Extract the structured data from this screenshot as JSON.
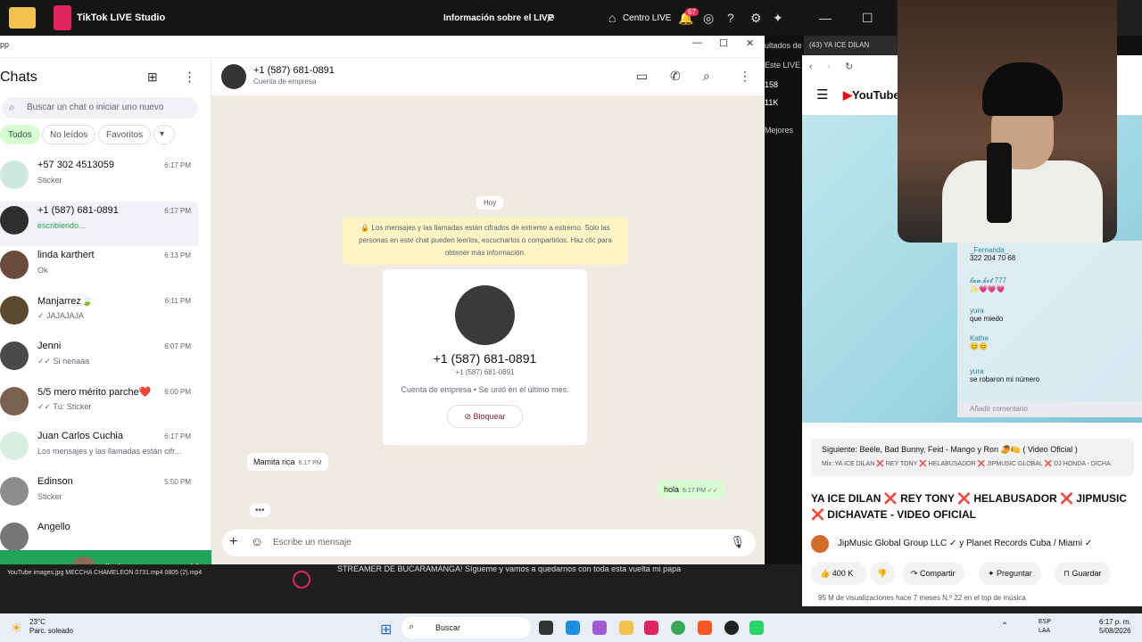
{
  "tiktok_bar": {
    "title": "TikTok LIVE Studio",
    "live_info": "Información sobre el LIVE",
    "centro": "Centro LIVE",
    "notif_count": "67"
  },
  "whatsapp": {
    "app_fragment": "pp",
    "chats_title": "Chats",
    "search_placeholder": "Buscar un chat o iniciar uno nuevo",
    "filters": [
      "Todos",
      "No leídos",
      "Favoritos"
    ],
    "chats": [
      {
        "name": "+57 302 4513059",
        "time": "6:17 PM",
        "preview": "Sticker",
        "avatar": "#cfe9e1"
      },
      {
        "name": "+1 (587) 681-0891",
        "time": "6:17 PM",
        "preview": "escribiendo...",
        "avatar": "#2e2e2e"
      },
      {
        "name": "linda karthert",
        "time": "6:13 PM",
        "preview": "Ok",
        "avatar": "#6b4b3a"
      },
      {
        "name": "Manjarrez🍃",
        "time": "6:11 PM",
        "preview": "✓ JAJAJAJA",
        "avatar": "#5b4a2e"
      },
      {
        "name": "Jenni",
        "time": "6:07 PM",
        "preview": "✓✓ Si nenaaa",
        "avatar": "#4a4a4a"
      },
      {
        "name": "5/5 mero mérito parche❤️",
        "time": "6:00 PM",
        "preview": "✓✓ Tú: Sticker",
        "avatar": "#7a6050"
      },
      {
        "name": "Juan Carlos Cuchia",
        "time": "6:17 PM",
        "preview": "Los mensajes y las llamadas están cifr...",
        "avatar": "#d9efe3"
      },
      {
        "name": "Edinson",
        "time": "5:50 PM",
        "preview": "Sticker",
        "avatar": "#8c8c8c"
      },
      {
        "name": "Angello",
        "time": "",
        "preview": "",
        "avatar": "#777"
      }
    ],
    "call_bar_name": "linda",
    "conversation": {
      "name": "+1 (587) 681-0891",
      "subtitle": "Cuenta de empresa",
      "day": "Hoy",
      "encryption_note": "🔒 Los mensajes y las llamadas están cifrados de extremo a extremo. Solo las personas en este chat pueden leerlos, escucharlos o compartirlos. Haz clic para obtener más información.",
      "card_phone": "+1 (587) 681-0891",
      "card_phone_small": "+1 (587) 681-0891",
      "card_desc": "Cuenta de empresa • Se unió en el último mes.",
      "block_label": "Bloquear",
      "msg_in": "Mamita rica",
      "msg_in_time": "6:17 PM",
      "msg_out": "hola",
      "msg_out_time": "6:17 PM",
      "typing": "•••",
      "composer_placeholder": "Escribe un mensaje"
    }
  },
  "youtube": {
    "tab_title": "(43) YA ICE DILAN",
    "logo": "YouTube",
    "next_title": "Siguiente: Beéle, Bad Bunny, Feid - Mango y Ron 🥭🍋 ( Video Oficial )",
    "next_sub": "Mix: YA ICE DILAN ❌ REY TONY ❌ HELABUSADOR ❌ JIPMUSIC GLOBAL ❌ DJ HONDA - DICHA",
    "video_title": "YA ICE DILAN ❌ REY TONY ❌ HELABUSADOR ❌ JIPMUSIC ❌ DICHAVATE - VIDEO OFICIAL",
    "channel": "JipMusic Global Group LLC ✓ y Planet Records Cuba / Miami ✓",
    "likes": "400 K",
    "share": "Compartir",
    "ask": "Preguntar",
    "save": "Guardar",
    "views": "95 M de visualizaciones  hace 7 meses  N.º 22 en el top de música"
  },
  "tiktok_comments": [
    {
      "user": "_Fernanda_",
      "text": "322 204 70 68"
    },
    {
      "user": "𝓵𝓪𝓪.𝓫𝓸𝓽 777",
      "text": "✨💗💗💗"
    },
    {
      "user": "yura",
      "text": "que miedo"
    },
    {
      "user": "Kathe",
      "text": "😊😊"
    },
    {
      "user": "yura",
      "text": "se robaron mi número"
    }
  ],
  "comment_placeholder": "Añadir comentario",
  "tiktok_stats": [
    "158",
    "11K",
    "Mejores"
  ],
  "side_labels": [
    "ultados de",
    "Este LIVE"
  ],
  "bottom": {
    "files": "YouTube     images.jpg     MECCHA CHAMELEON     0731.mp4     0805 (2).mp4",
    "streamer_msg": "STREAMER DE BUCARAMANGA! Sígueme y vamos a quedarnos con toda esta vuelta mi papa"
  },
  "taskbar": {
    "temp": "23°C",
    "weather": "Parc. soleado",
    "search": "Buscar",
    "lang1": "ESP",
    "lang2": "LAA",
    "time": "6:17 p. m.",
    "date": "5/08/2026"
  }
}
